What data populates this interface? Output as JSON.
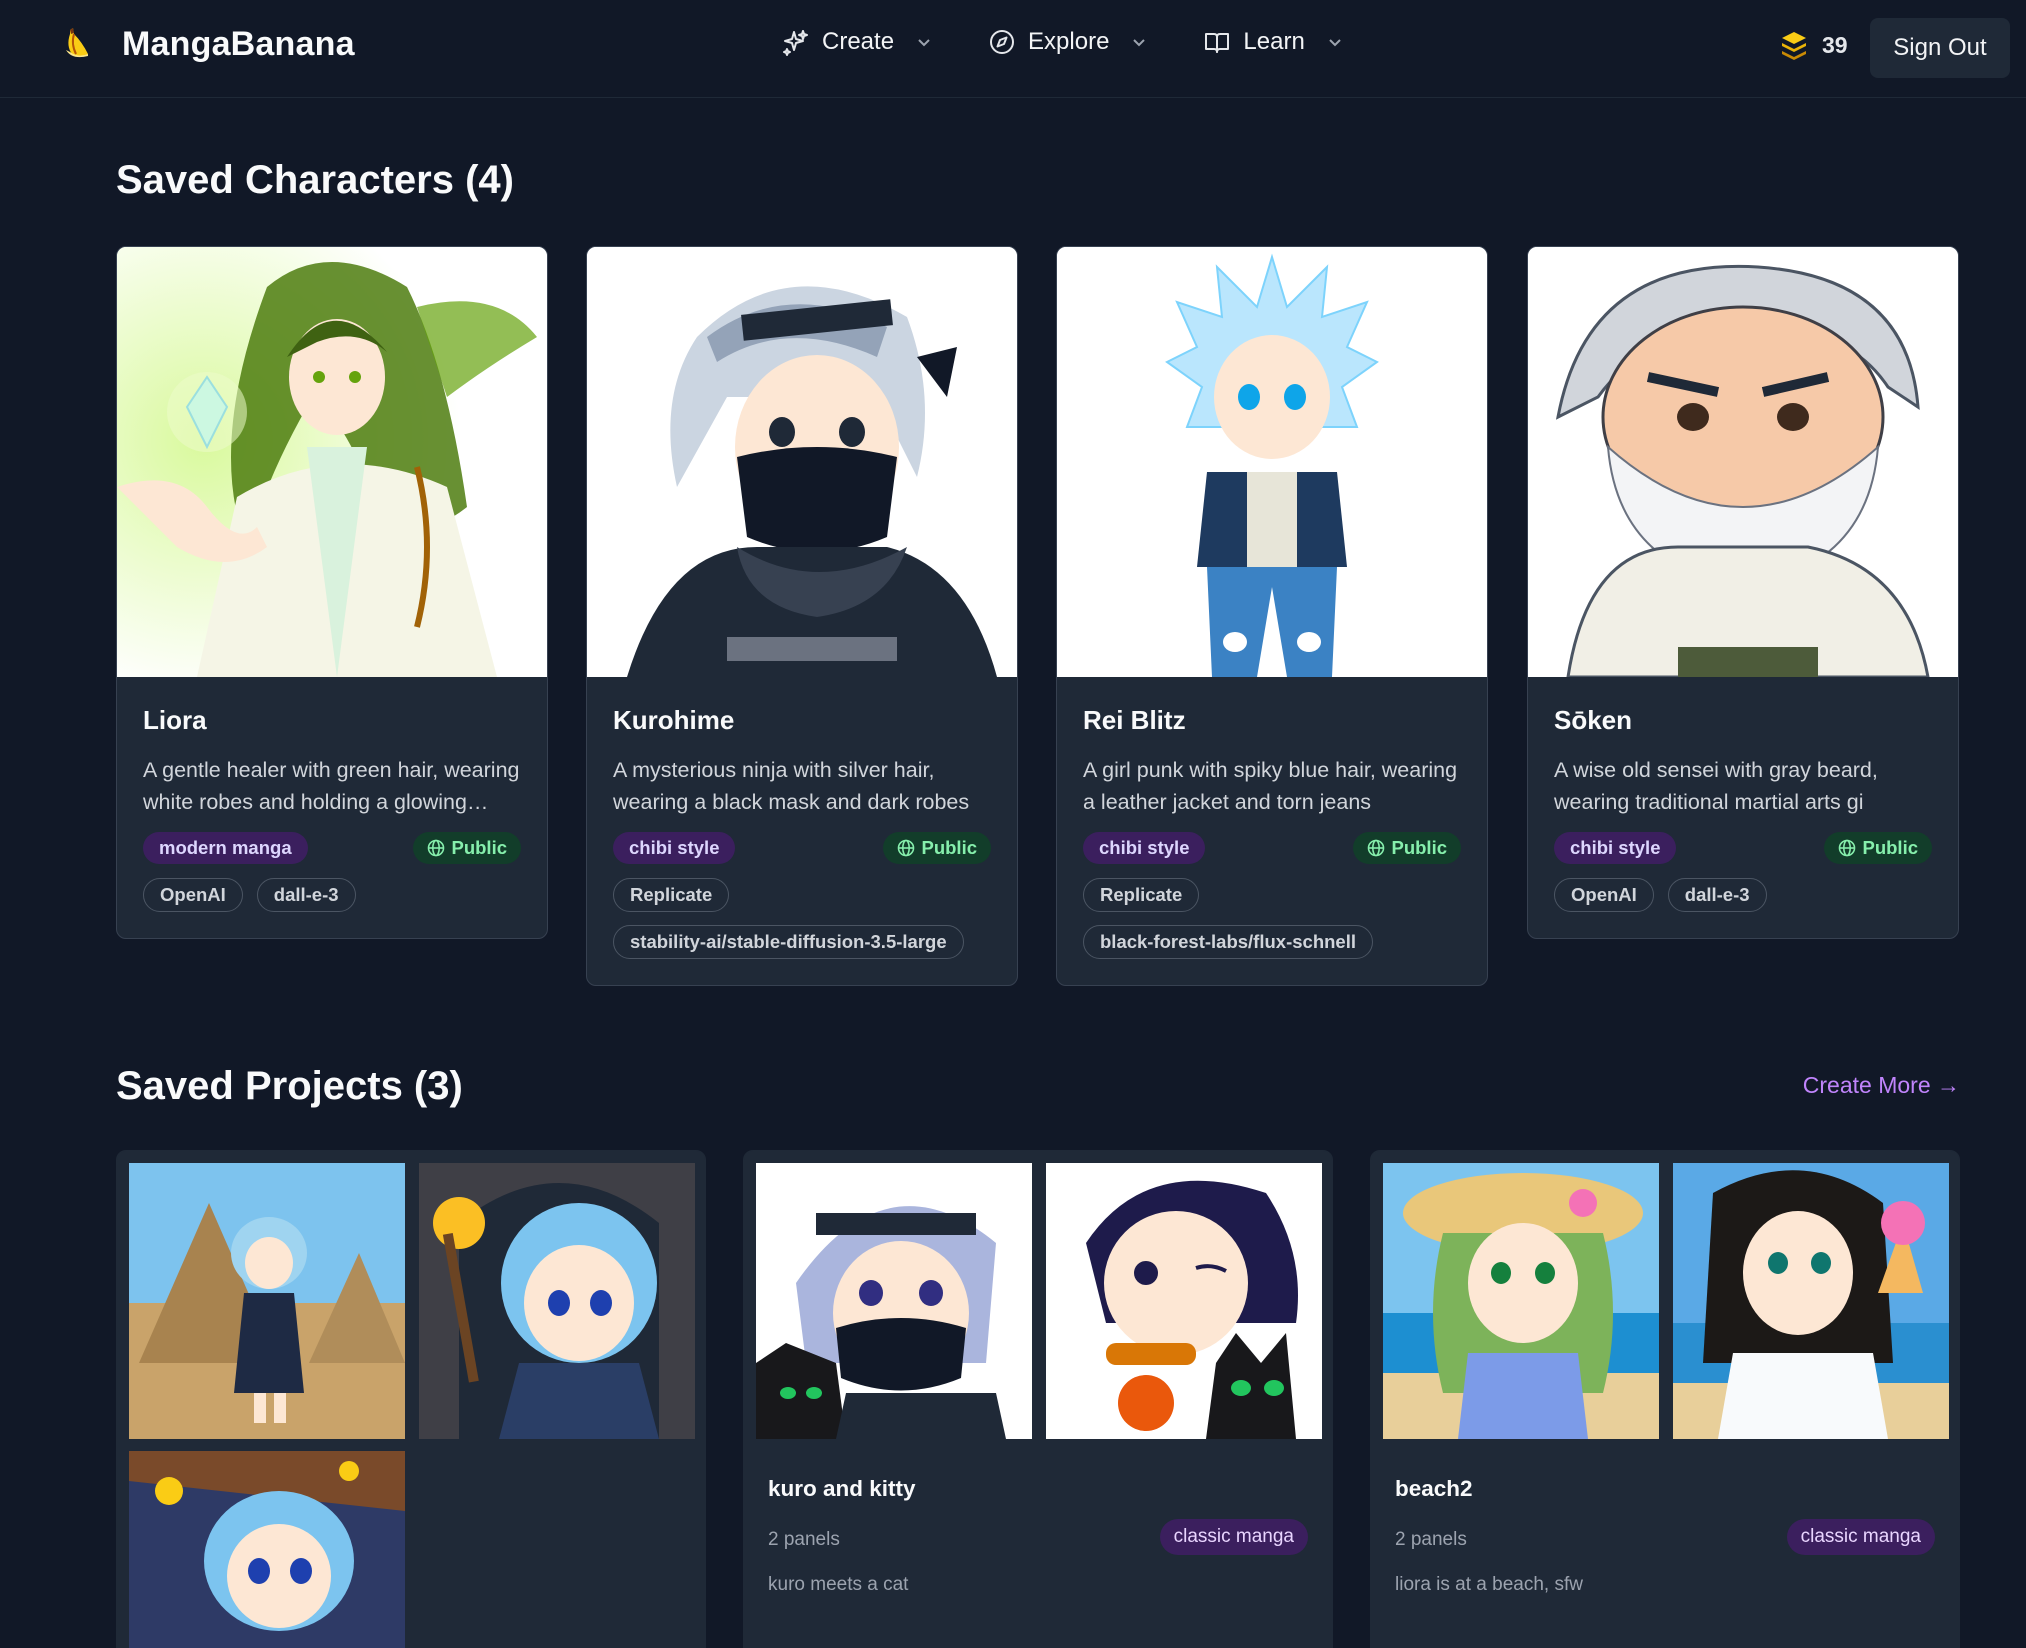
{
  "nav": {
    "brand": "MangaBanana",
    "menu": [
      {
        "label": "Create",
        "icon": "sparkles-icon"
      },
      {
        "label": "Explore",
        "icon": "compass-icon"
      },
      {
        "label": "Learn",
        "icon": "book-icon"
      }
    ],
    "credits": "39",
    "sign_out": "Sign Out"
  },
  "characters_section": {
    "title": "Saved Characters (4)",
    "cards": [
      {
        "name": "Liora",
        "description": "A gentle healer with green hair, wearing white robes and holding a glowing crystal",
        "style": "modern manga",
        "visibility": "Public",
        "provider": "OpenAI",
        "model": "dall-e-3"
      },
      {
        "name": "Kurohime",
        "description": "A mysterious ninja with silver hair, wearing a black mask and dark robes",
        "style": "chibi style",
        "visibility": "Public",
        "provider": "Replicate",
        "model": "stability-ai/stable-diffusion-3.5-large"
      },
      {
        "name": "Rei Blitz",
        "description": "A girl punk with spiky blue hair, wearing a leather jacket and torn jeans",
        "style": "chibi style",
        "visibility": "Public",
        "provider": "Replicate",
        "model": "black-forest-labs/flux-schnell"
      },
      {
        "name": "Sōken",
        "description": "A wise old sensei with gray beard, wearing traditional martial arts gi",
        "style": "chibi style",
        "visibility": "Public",
        "provider": "OpenAI",
        "model": "dall-e-3"
      }
    ]
  },
  "projects_section": {
    "title": "Saved Projects (3)",
    "create_more": "Create More →",
    "cards": [
      {
        "title": "",
        "panels": "",
        "style": "",
        "description": ""
      },
      {
        "title": "kuro and kitty",
        "panels": "2 panels",
        "style": "classic manga",
        "description": "kuro meets a cat"
      },
      {
        "title": "beach2",
        "panels": "2 panels",
        "style": "classic manga",
        "description": "liora is at a beach, sfw"
      }
    ]
  },
  "colors": {
    "background": "#111827",
    "card": "#1f2937",
    "accent": "#c084fc",
    "style_badge": "#3b1f5e",
    "public_badge": "#123d2a"
  }
}
